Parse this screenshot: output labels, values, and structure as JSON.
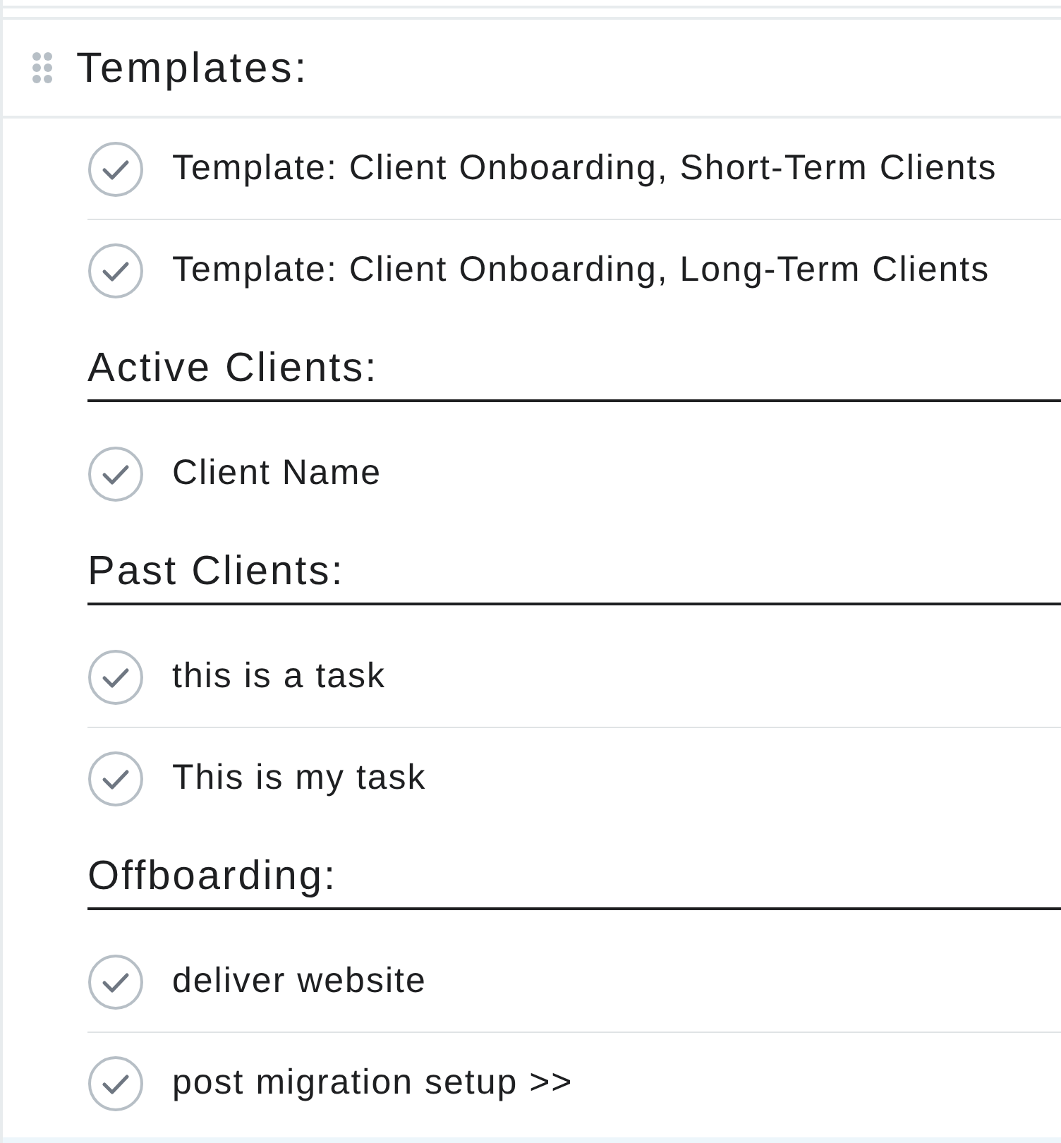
{
  "header": {
    "title": "Templates:"
  },
  "tasks": [
    {
      "name": "Template: Client Onboarding, Short-Term Clients"
    },
    {
      "name": "Template: Client Onboarding, Long-Term Clients"
    }
  ],
  "sections": [
    {
      "title": "Active Clients:",
      "tasks": [
        {
          "name": "Client Name"
        }
      ]
    },
    {
      "title": "Past Clients:",
      "tasks": [
        {
          "name": "this is a task"
        },
        {
          "name": "This is my task"
        }
      ]
    },
    {
      "title": "Offboarding:",
      "tasks": [
        {
          "name": "deliver website"
        },
        {
          "name": "post migration setup >>"
        }
      ]
    }
  ]
}
